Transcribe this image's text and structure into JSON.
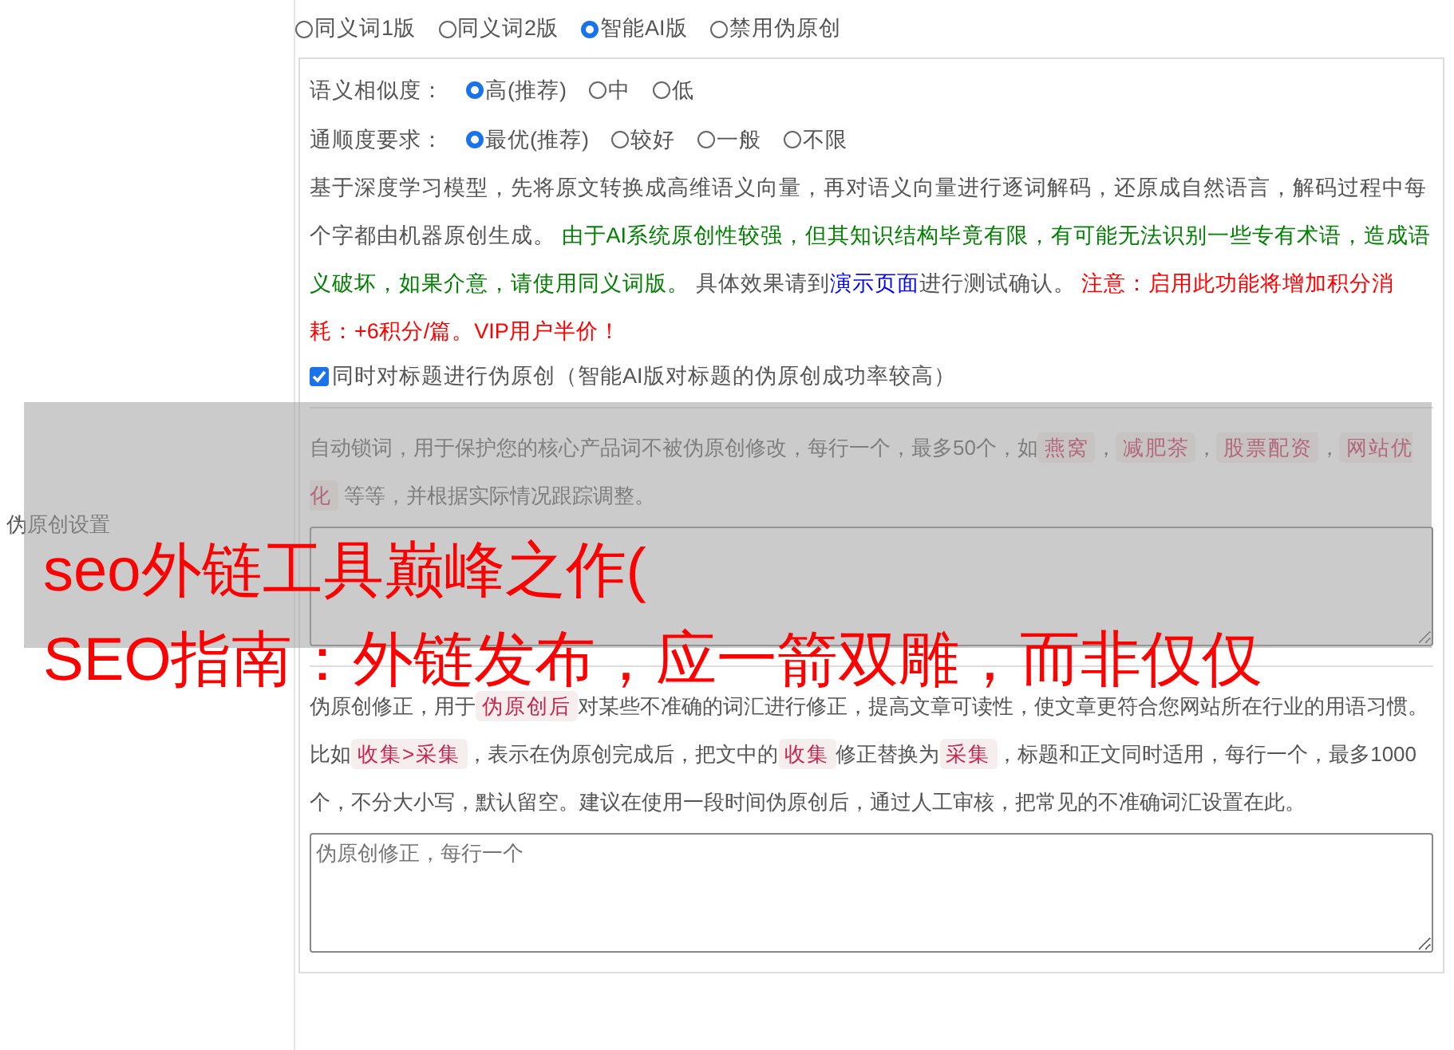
{
  "side_label": "伪原创设置",
  "mode_options": [
    {
      "label": "同义词1版",
      "selected": false
    },
    {
      "label": "同义词2版",
      "selected": false
    },
    {
      "label": "智能AI版",
      "selected": true
    },
    {
      "label": "禁用伪原创",
      "selected": false
    }
  ],
  "ai_settings": {
    "similarity": {
      "label": "语义相似度：",
      "options": [
        {
          "label": "高(推荐)",
          "selected": true
        },
        {
          "label": "中",
          "selected": false
        },
        {
          "label": "低",
          "selected": false
        }
      ]
    },
    "fluency": {
      "label": "通顺度要求：",
      "options": [
        {
          "label": "最优(推荐)",
          "selected": true
        },
        {
          "label": "较好",
          "selected": false
        },
        {
          "label": "一般",
          "selected": false
        },
        {
          "label": "不限",
          "selected": false
        }
      ]
    },
    "description": [
      {
        "kind": "normal",
        "text": "基于深度学习模型，先将原文转换成高维语义向量，再对语义向量进行逐词解码，还原成自然语言，解码过程中每个字都由机器原创生成。 "
      },
      {
        "kind": "green",
        "text": "由于AI系统原创性较强，但其知识结构毕竟有限，有可能无法识别一些专有术语，造成语义破坏，如果介意，请使用同义词版。"
      },
      {
        "kind": "normal",
        "text": " 具体效果请到"
      },
      {
        "kind": "link",
        "text": "演示页面"
      },
      {
        "kind": "normal",
        "text": "进行测试确认。 "
      },
      {
        "kind": "red",
        "text": "注意：启用此功能将增加积分消耗：+6积分/篇。VIP用户半价！"
      }
    ],
    "title_checkbox": {
      "label": "同时对标题进行伪原创（智能AI版对标题的伪原创成功率较高）",
      "checked": true
    }
  },
  "lock_words": {
    "description": [
      {
        "kind": "normal",
        "text": "自动锁词，用于保护您的核心产品词不被伪原创修改，每行一个，最多50个，如"
      },
      {
        "kind": "tag",
        "text": "燕窝"
      },
      {
        "kind": "normal",
        "text": "，"
      },
      {
        "kind": "tag",
        "text": "减肥茶"
      },
      {
        "kind": "normal",
        "text": "，"
      },
      {
        "kind": "tag",
        "text": "股票配资"
      },
      {
        "kind": "normal",
        "text": "，"
      },
      {
        "kind": "tag",
        "text": "网站优化"
      },
      {
        "kind": "normal",
        "text": " 等等，并根据实际情况跟踪调整。"
      }
    ]
  },
  "correction": {
    "description": [
      {
        "kind": "normal",
        "text": "伪原创修正，用于"
      },
      {
        "kind": "tag",
        "text": "伪原创后"
      },
      {
        "kind": "normal",
        "text": "对某些不准确的词汇进行修正，提高文章可读性，使文章更符合您网站所在行业的用语习惯。比如"
      },
      {
        "kind": "tag",
        "text": "收集>采集"
      },
      {
        "kind": "normal",
        "text": "，表示在伪原创完成后，把文中的"
      },
      {
        "kind": "tag",
        "text": "收集"
      },
      {
        "kind": "normal",
        "text": "修正替换为"
      },
      {
        "kind": "tag",
        "text": "采集"
      },
      {
        "kind": "normal",
        "text": "，标题和正文同时适用，每行一个，最多1000个，不分大小写，默认留空。建议在使用一段时间伪原创后，通过人工审核，把常见的不准确词汇设置在此。"
      }
    ],
    "placeholder": "伪原创修正，每行一个"
  },
  "overlay": {
    "lines": [
      "seo外链工具巅峰之作(",
      "SEO指南：外链发布，应一箭双雕，而非仅仅"
    ]
  }
}
